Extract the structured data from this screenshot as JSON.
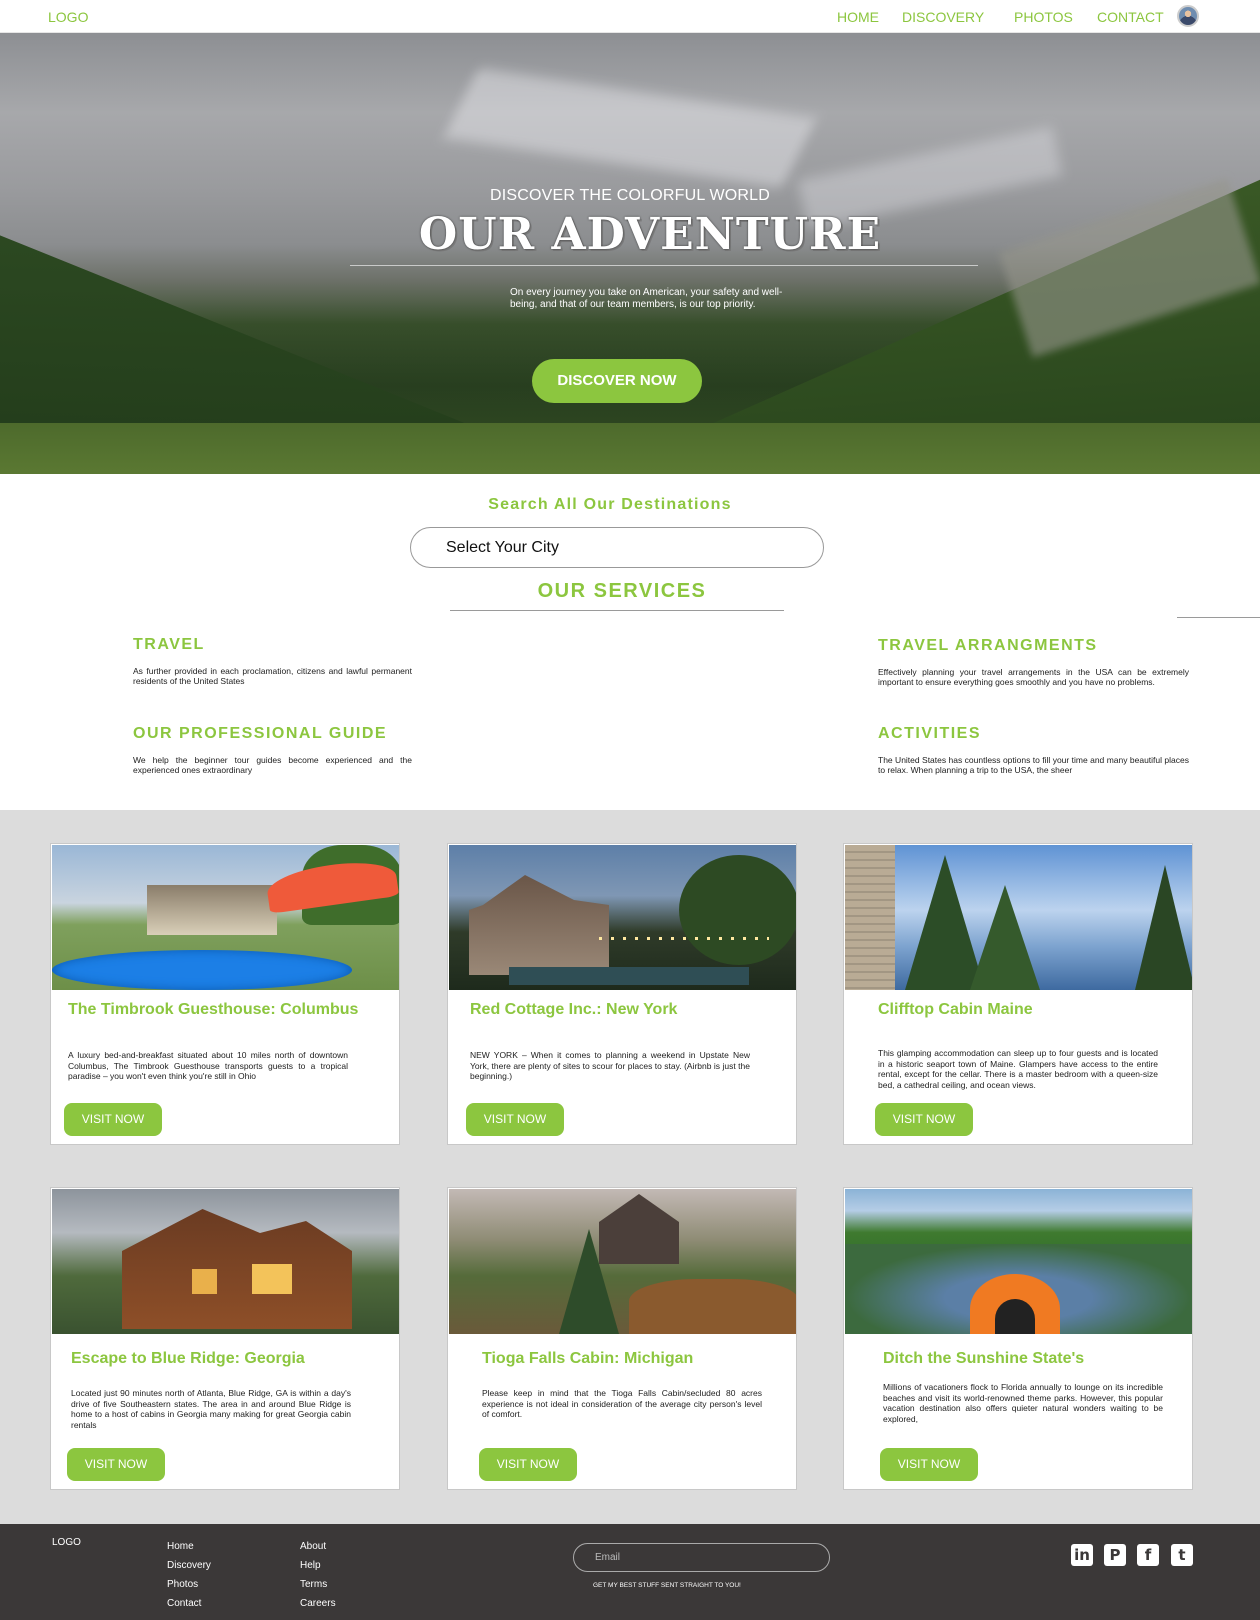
{
  "nav": {
    "logo": "LOGO",
    "links": [
      "HOME",
      "DISCOVERY",
      "PHOTOS",
      "CONTACT"
    ]
  },
  "hero": {
    "subtitle": "DISCOVER THE COLORFUL WORLD",
    "title": "OUR ADVENTURE",
    "description": "On every journey you take on American, your safety and well-being, and that of our team members, is our top priority.",
    "cta": "DISCOVER NOW"
  },
  "search": {
    "title": "Search All Our Destinations",
    "value": "Select Your City"
  },
  "services": {
    "title": "OUR SERVICES",
    "items": [
      {
        "title": "TRAVEL",
        "text": "As further provided in each proclamation, citizens and lawful permanent residents of the United States"
      },
      {
        "title": "OUR PROFESSIONAL GUIDE",
        "text": "We help the beginner tour guides become experienced and the experienced ones extraordinary"
      },
      {
        "title": "TRAVEL ARRANGMENTS",
        "text": "Effectively planning your travel arrangements in the USA can be extremely important to ensure everything goes smoothly and you have no problems."
      },
      {
        "title": "ACTIVITIES",
        "text": "The United States has countless options to fill your time and many beautiful places to relax. When planning a trip to the USA, the sheer"
      }
    ]
  },
  "cards": [
    {
      "title": "The Timbrook Guesthouse: Columbus",
      "text": "A luxury bed-and-breakfast situated about 10 miles north of downtown Columbus, The Timbrook Guesthouse transports guests to a tropical paradise – you won't even think you're still in Ohio",
      "button": "VISIT NOW"
    },
    {
      "title": "Red Cottage Inc.: New York",
      "text": "NEW YORK – When it comes to planning a weekend in Upstate New York, there are plenty of sites to scour for places to stay. (Airbnb is just the beginning.)",
      "button": "VISIT NOW"
    },
    {
      "title": "Clifftop Cabin Maine",
      "text": "This glamping accommodation can sleep up to four guests and is located in a historic seaport town of Maine. Glampers have access to the entire rental, except for the cellar. There is a master bedroom with a queen-size bed, a cathedral ceiling, and ocean views.",
      "button": "VISIT NOW"
    },
    {
      "title": "Escape to Blue Ridge: Georgia",
      "text": "Located just 90 minutes north of Atlanta, Blue Ridge, GA is within a day's drive of five Southeastern states. The area in and around Blue Ridge is home to a host of cabins in Georgia many making for great Georgia cabin rentals",
      "button": "VISIT NOW"
    },
    {
      "title": "Tioga Falls Cabin: Michigan",
      "text": "Please keep in mind that the Tioga Falls Cabin/secluded 80 acres experience is not ideal in consideration of the average city person's level of comfort.",
      "button": "VISIT NOW"
    },
    {
      "title": "Ditch the Sunshine State's",
      "text": "Millions of vacationers flock to Florida annually to lounge on its incredible beaches and visit its world-renowned theme parks. However, this popular vacation destination also offers quieter natural wonders waiting to be explored,",
      "button": "VISIT NOW"
    }
  ],
  "footer": {
    "logo": "LOGO",
    "col1": [
      "Home",
      "Discovery",
      "Photos",
      "Contact"
    ],
    "col2": [
      "About",
      "Help",
      "Terms",
      "Careers"
    ],
    "email_placeholder": "Email",
    "tagline": "GET MY BEST STUFF SENT STRAIGHT TO YOU!",
    "social": [
      {
        "icon": "linkedin-icon",
        "glyph": "in"
      },
      {
        "icon": "pinterest-icon",
        "glyph": "P"
      },
      {
        "icon": "facebook-icon",
        "glyph": "f"
      },
      {
        "icon": "twitter-icon",
        "glyph": "t"
      }
    ]
  },
  "colors": {
    "accent": "#8cc63f",
    "footer_bg": "#3b3838",
    "grid_bg": "#dcdcdc"
  }
}
